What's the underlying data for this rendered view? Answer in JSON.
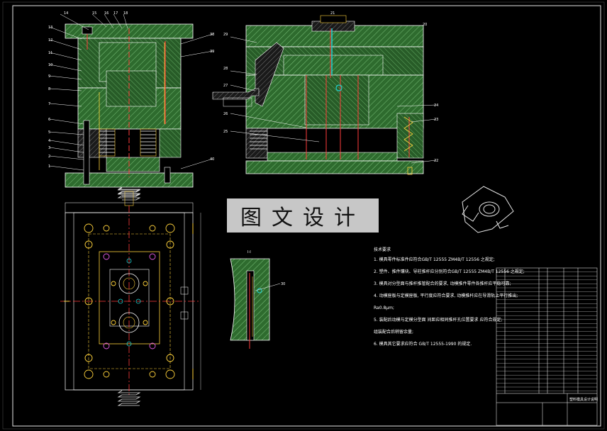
{
  "watermark": {
    "text": "图文设计"
  },
  "section_label": "I-I",
  "section_balloon": "30",
  "notes": {
    "title": "技术要求",
    "lines": [
      "1. 模具零件标准件应符合GB/T 12555 ZM4B/T 12556 之规定;",
      "2. 塑件、推件镶块、导柱推杆应分别符合GB/T 12555 ZM4B/T 12556 之规定;",
      "3. 模具对分型面与推杆推管配合的要求, 动模推件零件各推杆应平稳可靠;",
      "4. 动模座板与定模座板, 平行度应符合要求, 动模推杆应在导滑轨上平行推出;",
      "   Ra0.8μm;",
      "5. 装配后动模与定模分型面 间距应相同推杆孔位置要求 应符合规定;",
      "   组装配合后稍留余量;",
      "6. 模具其它要求应符合 GB/T 12555-1990 的规定."
    ]
  },
  "balloons_left": [
    "14",
    "15",
    "16",
    "17",
    "18",
    "13",
    "12",
    "11",
    "10",
    "9",
    "8",
    "7",
    "6",
    "5",
    "4",
    "3",
    "2",
    "1"
  ],
  "balloons_right": [
    "38",
    "39",
    "40",
    "29",
    "28",
    "27",
    "26",
    "25",
    "24",
    "23",
    "22",
    "21",
    "20"
  ],
  "titleblock": {
    "label": "塑料模具设计说明"
  }
}
